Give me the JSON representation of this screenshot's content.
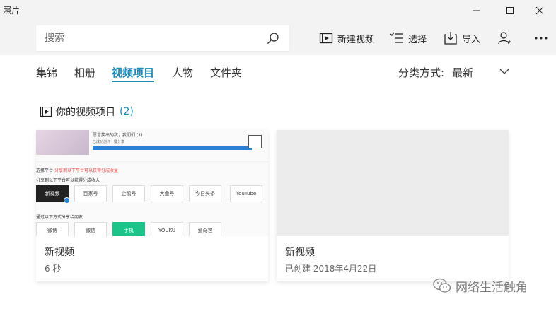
{
  "app": {
    "title": "照片"
  },
  "search": {
    "placeholder": "搜索"
  },
  "toolbar": {
    "new_video": "新建视频",
    "select": "选择",
    "import": "导入"
  },
  "tabs": [
    {
      "label": "集锦",
      "active": false
    },
    {
      "label": "相册",
      "active": false
    },
    {
      "label": "视频项目",
      "active": true
    },
    {
      "label": "人物",
      "active": false
    },
    {
      "label": "文件夹",
      "active": false
    }
  ],
  "sort": {
    "label": "分类方式:",
    "value": "最新"
  },
  "section": {
    "title": "你的视频项目",
    "count": "(2)"
  },
  "cards": [
    {
      "title": "新视频",
      "subtitle": "6 秒"
    },
    {
      "title": "新视频",
      "subtitle": "已创建 2018年4月22日"
    }
  ],
  "thumbnail": {
    "line1": "愿意笑出的我，我们们 (1)",
    "line2": "已成功创作一键分享",
    "progress": 1.0,
    "label1": "选择平台",
    "label1_note": "分享到以下平台可以获得分成收益",
    "label2": "分享到以下平台可以获得分成收入",
    "platforms_row1": [
      "新视频",
      "百家号",
      "企鹅号",
      "大鱼号",
      "今日头条",
      "YouTube"
    ],
    "label3": "通过以下方式分享给朋友",
    "platforms_row2": [
      "微博",
      "微信",
      "手机",
      "YOUKU",
      "爱奇艺"
    ]
  },
  "watermark": {
    "text": "网络生活触角"
  },
  "colors": {
    "accent": "#1a8cb8",
    "progress": "#2b7fd6"
  }
}
